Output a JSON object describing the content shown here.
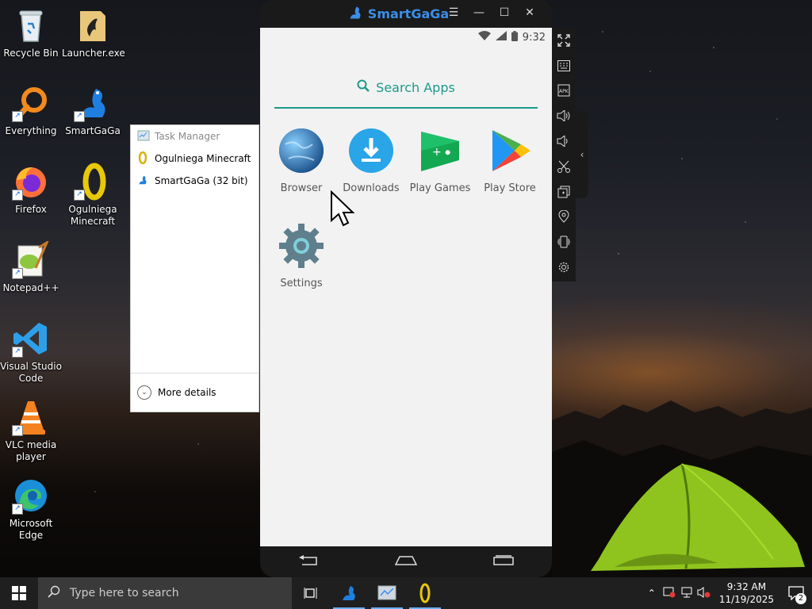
{
  "desktop": {
    "icons": [
      {
        "label": "Recycle Bin",
        "icon": "recycle-bin-icon"
      },
      {
        "label": "Launcher.exe",
        "icon": "launcher-icon"
      },
      {
        "label": "Everything",
        "icon": "everything-search-icon"
      },
      {
        "label": "SmartGaGa",
        "icon": "smartgaga-icon"
      },
      {
        "label": "Firefox",
        "icon": "firefox-icon"
      },
      {
        "label": "Ogulniega Minecraft",
        "icon": "minecraft-launcher-icon"
      },
      {
        "label": "Notepad++",
        "icon": "notepadpp-icon"
      },
      {
        "label": "Visual Studio Code",
        "icon": "vscode-icon"
      },
      {
        "label": "VLC media player",
        "icon": "vlc-icon"
      },
      {
        "label": "Microsoft Edge",
        "icon": "edge-icon"
      }
    ]
  },
  "taskmgr": {
    "title": "Task Manager",
    "items": [
      "Ogulniega Minecraft",
      "SmartGaGa (32 bit)"
    ],
    "more": "More details"
  },
  "emulator": {
    "brand": "SmartGaGa",
    "time": "9:32",
    "search_label": "Search Apps",
    "apps": [
      {
        "label": "Browser",
        "icon": "browser-globe-icon"
      },
      {
        "label": "Downloads",
        "icon": "downloads-icon"
      },
      {
        "label": "Play Games",
        "icon": "play-games-icon"
      },
      {
        "label": "Play Store",
        "icon": "play-store-icon"
      },
      {
        "label": "Settings",
        "icon": "settings-gear-icon"
      }
    ],
    "accent": "#1c9a8a"
  },
  "taskbar": {
    "search_placeholder": "Type here to search",
    "time": "9:32 AM",
    "date": "11/19/2025",
    "notifications": "2"
  }
}
